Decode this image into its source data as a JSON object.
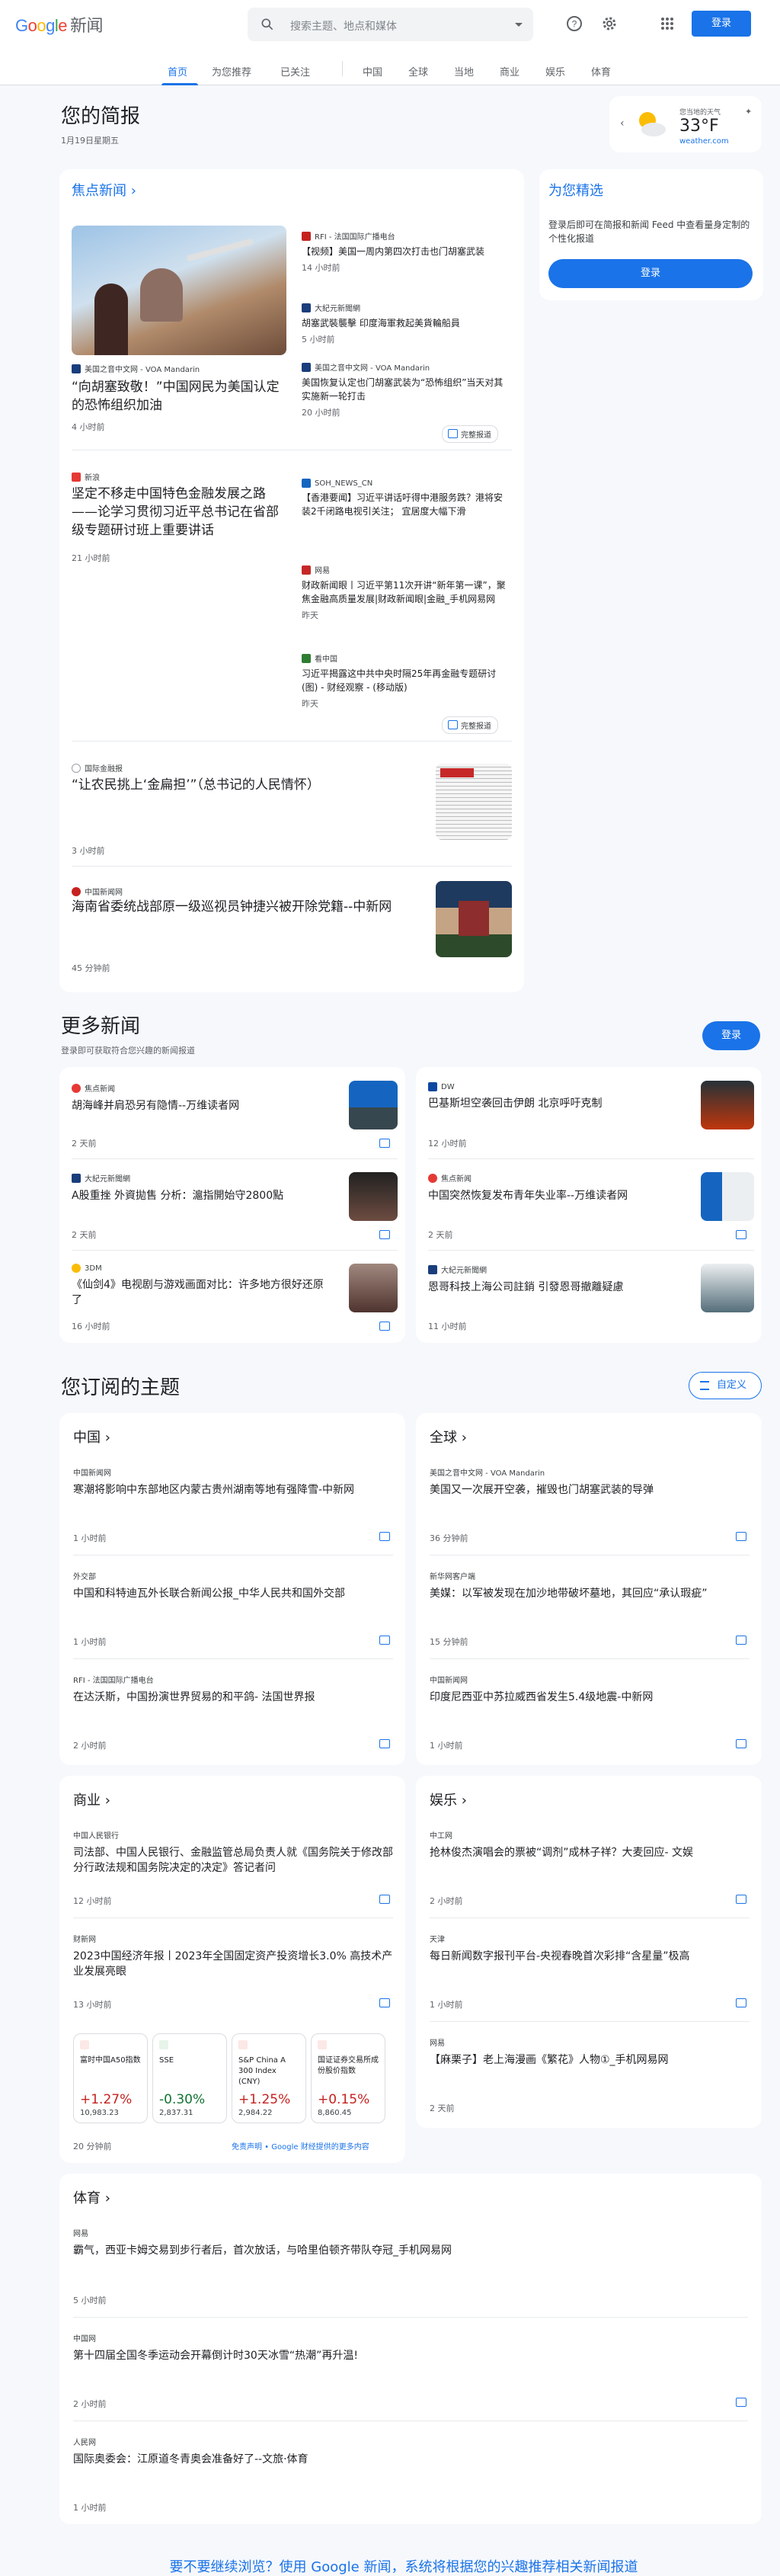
{
  "header": {
    "logo_google": "Google",
    "logo_news": "新闻",
    "search_placeholder": "搜索主题、地点和媒体",
    "signin": "登录"
  },
  "nav": [
    "首页",
    "为您推荐",
    "已关注",
    "中国",
    "全球",
    "当地",
    "商业",
    "娱乐",
    "体育"
  ],
  "briefing": {
    "title": "您的简报",
    "date": "1月19日星期五"
  },
  "weather": {
    "label": "您当地的天气",
    "temp": "33°F",
    "source": "weather.com"
  },
  "top": {
    "title": "焦点新闻",
    "main1": {
      "source": "美国之音中文网 - VOA Mandarin",
      "title": "“向胡塞致敬！”中国网民为美国认定的恐怖组织加油",
      "time": "4 小时前"
    },
    "side1": [
      {
        "source": "RFI - 法国国际广播电台",
        "title": "【视频】美国一周内第四次打击也门胡塞武装",
        "time": "14 小时前"
      },
      {
        "source": "大紀元新聞網",
        "title": "胡塞武裝襲擊 印度海軍救起美貨輪船員",
        "time": "5 小时前"
      },
      {
        "source": "美国之音中文网 - VOA Mandarin",
        "title": "美国恢复认定也门胡塞武装为“恐怖组织”当天对其实施新一轮打击",
        "time": "20 小时前"
      }
    ],
    "full_coverage": "完整报道",
    "main2": {
      "source": "新浪",
      "title": "坚定不移走中国特色金融发展之路——论学习贯彻习近平总书记在省部级专题研讨班上重要讲话",
      "time": "21 小时前"
    },
    "side2": [
      {
        "source": "SOH_NEWS_CN",
        "title": "【香港要闻】习近平讲话吁得中港服务跌？港将安装2千闭路电视引关注； 宜居度大幅下滑",
        "time": "昨天"
      },
      {
        "source": "网易",
        "title": "财政新闻眼丨习近平第11次开讲“新年第一课”，聚焦金融高质量发展|财政新闻眼|金融_手机网易网",
        "time": "昨天"
      },
      {
        "source": "看中国",
        "title": "习近平揭露这中共中央时隔25年再金融专题研讨(图) - 财经观察 - (移动版)",
        "time": "昨天"
      }
    ],
    "story3": {
      "source": "国际金融报",
      "title": "“让农民挑上‘金扁担’”（总书记的人民情怀）",
      "time": "3 小时前"
    },
    "story4": {
      "source": "中国新闻网",
      "title": "海南省委统战部原一级巡视员钟捷兴被开除党籍--中新网",
      "time": "45 分钟前"
    }
  },
  "foryou": {
    "title": "为您精选",
    "text": "登录后即可在简报和新闻 Feed 中查看量身定制的个性化报道",
    "signin": "登录"
  },
  "more": {
    "title": "更多新闻",
    "subtitle": "登录即可获取符合您兴趣的新闻报道",
    "signin": "登录",
    "items": [
      {
        "source": "焦点新闻",
        "title": "胡海峰并肩恐另有隐情--万维读者网",
        "time": "2 天前"
      },
      {
        "source": "DW",
        "title": "巴基斯坦空袭回击伊朗 北京呼吁克制",
        "time": "12 小时前"
      },
      {
        "source": "大紀元新聞網",
        "title": "A股重挫 外資拋售 分析：滬指開始守2800點",
        "time": "2 天前"
      },
      {
        "source": "焦点新闻",
        "title": "中国突然恢复发布青年失业率--万维读者网",
        "time": "2 天前"
      },
      {
        "source": "3DM",
        "title": "《仙剑4》电视剧与游戏画面对比：许多地方很好还原了",
        "time": "16 小时前"
      },
      {
        "source": "大紀元新聞網",
        "title": "恩哥科技上海公司註銷 引發恩哥撤離疑慮",
        "time": "11 小时前"
      }
    ]
  },
  "topics": {
    "title": "您订阅的主题",
    "customize": "自定义",
    "china": {
      "title": "中国",
      "items": [
        {
          "source": "中国新闻网",
          "title": "寒潮将影响中东部地区内蒙古贵州湖南等地有强降雪-中新网",
          "time": "1 小时前"
        },
        {
          "source": "外交部",
          "title": "中国和科特迪瓦外长联合新闻公报_中华人民共和国外交部",
          "time": "1 小时前"
        },
        {
          "source": "RFI - 法国国际广播电台",
          "title": "在达沃斯，中国扮演世界贸易的和平鸽- 法国世界报",
          "time": "2 小时前"
        }
      ]
    },
    "world": {
      "title": "全球",
      "items": [
        {
          "source": "美国之音中文网 - VOA Mandarin",
          "title": "美国又一次展开空袭，摧毁也门胡塞武装的导弹",
          "time": "36 分钟前"
        },
        {
          "source": "新华网客户端",
          "title": "美媒：以军被发现在加沙地带破坏墓地，其回应“承认瑕疵”",
          "time": "15 分钟前"
        },
        {
          "source": "中国新闻网",
          "title": "印度尼西亚中苏拉威西省发生5.4级地震-中新网",
          "time": "1 小时前"
        }
      ]
    },
    "business": {
      "title": "商业",
      "items": [
        {
          "source": "中国人民银行",
          "title": "司法部、中国人民银行、金融监管总局负责人就《国务院关于修改部分行政法规和国务院决定的决定》答记者问",
          "time": "12 小时前"
        },
        {
          "source": "财新网",
          "title": "2023中国经济年报丨2023年全国固定资产投资增长3.0% 高技术产业发展亮眼",
          "time": "13 小时前"
        }
      ],
      "stocks": [
        {
          "name": "富时中国A50指数",
          "pct": "+1.27%",
          "val": "10,983.23",
          "dir": "up"
        },
        {
          "name": "SSE",
          "pct": "-0.30%",
          "val": "2,837.31",
          "dir": "down"
        },
        {
          "name": "S&P China A 300 Index (CNY)",
          "pct": "+1.25%",
          "val": "2,984.22",
          "dir": "up"
        },
        {
          "name": "国证证券交易所成份股价指数",
          "pct": "+0.15%",
          "val": "8,860.45",
          "dir": "up"
        }
      ],
      "stocks_time": "20 分钟前",
      "disclaimer": "免责声明 • Google 财经提供的更多内容"
    },
    "ent": {
      "title": "娱乐",
      "items": [
        {
          "source": "中工网",
          "title": "抢林俊杰演唱会的票被“调剂”成林子祥？大麦回应- 文娱",
          "time": "2 小时前"
        },
        {
          "source": "天津",
          "title": "每日新闻数字报刊平台-央视春晚首次彩排“含星量”极高",
          "time": "1 小时前"
        },
        {
          "source": "网易",
          "title": "【麻栗子】老上海漫画《繁花》人物①_手机网易网",
          "time": "2 天前"
        }
      ]
    },
    "sports": {
      "title": "体育",
      "items": [
        {
          "source": "网易",
          "title": "霸气，西亚卡姆交易到步行者后，首次放话，与哈里伯顿齐带队夺冠_手机网易网",
          "time": "5 小时前"
        },
        {
          "source": "中国网",
          "title": "第十四届全国冬季运动会开幕倒计时30天冰雪“热潮”再升温!",
          "time": "2 小时前"
        },
        {
          "source": "人民网",
          "title": "国际奥委会：江原道冬青奥会准备好了--文旅·体育",
          "time": "1 小时前"
        }
      ]
    }
  },
  "footer": "要不要继续浏览？使用 Google 新闻，系统将根据您的兴趣推荐相关新闻报道",
  "colors": {
    "accent": "#1a73e8",
    "up": "#c5221f",
    "down": "#137333"
  }
}
